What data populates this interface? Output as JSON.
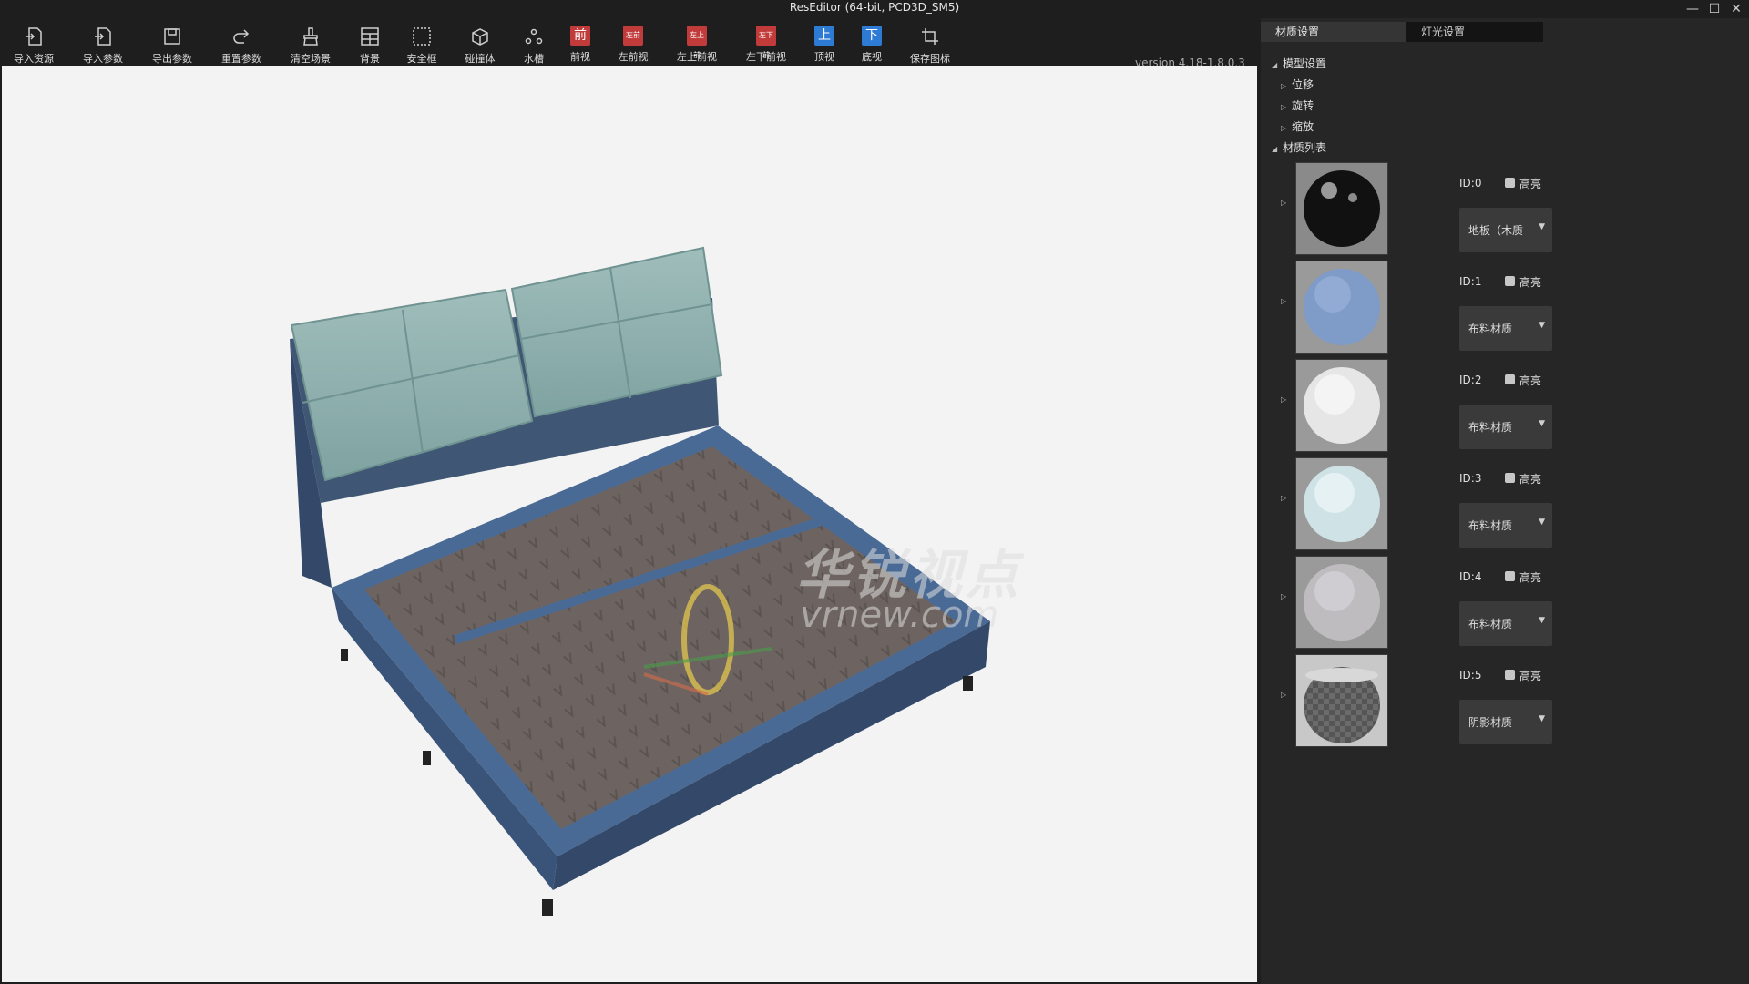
{
  "window": {
    "title": "ResEditor (64-bit, PCD3D_SM5)",
    "controls": [
      "—",
      "☐",
      "✕"
    ]
  },
  "toolbar": {
    "buttons": [
      {
        "label": "导入资源",
        "icon": "import-resource-icon"
      },
      {
        "label": "导入参数",
        "icon": "import-params-icon"
      },
      {
        "label": "导出参数",
        "icon": "export-params-icon"
      },
      {
        "label": "重置参数",
        "icon": "reset-params-icon"
      },
      {
        "label": "清空场景",
        "icon": "clear-scene-icon"
      },
      {
        "label": "背景",
        "icon": "background-icon"
      },
      {
        "label": "安全框",
        "icon": "safe-frame-icon"
      },
      {
        "label": "碰撞体",
        "icon": "collider-icon"
      },
      {
        "label": "水槽",
        "icon": "sink-icon"
      },
      {
        "label": "前视",
        "badge": "前",
        "color": "#c23b3b"
      },
      {
        "label": "左前视",
        "badge": "左前",
        "color": "#c23b3b"
      },
      {
        "label": "左上前视",
        "badge": "左上前",
        "color": "#c23b3b"
      },
      {
        "label": "左下前视",
        "badge": "左下前",
        "color": "#c23b3b"
      },
      {
        "label": "顶视",
        "badge": "上",
        "color": "#2e7bd6"
      },
      {
        "label": "底视",
        "badge": "下",
        "color": "#2e7bd6"
      },
      {
        "label": "保存图标",
        "icon": "crop-icon"
      }
    ],
    "version": "version 4.18-1.8.0.3"
  },
  "panel": {
    "tabs": [
      "材质设置",
      "灯光设置"
    ],
    "tree": {
      "model_settings": "模型设置",
      "translate": "位移",
      "rotate": "旋转",
      "scale": "缩放",
      "material_list": "材质列表"
    },
    "materials": [
      {
        "id": "ID:0",
        "highlight": "高亮",
        "type": "地板（木质",
        "preview": "glossy-black-sphere"
      },
      {
        "id": "ID:1",
        "highlight": "高亮",
        "type": "布料材质",
        "preview": "blue-fabric-sphere"
      },
      {
        "id": "ID:2",
        "highlight": "高亮",
        "type": "布料材质",
        "preview": "white-fabric-sphere"
      },
      {
        "id": "ID:3",
        "highlight": "高亮",
        "type": "布料材质",
        "preview": "pale-cyan-sphere"
      },
      {
        "id": "ID:4",
        "highlight": "高亮",
        "type": "布料材质",
        "preview": "grey-fabric-sphere"
      },
      {
        "id": "ID:5",
        "highlight": "高亮",
        "type": "阴影材质",
        "preview": "checker-shadow-sphere"
      }
    ]
  },
  "viewport": {
    "watermark_cn": "华锐视点",
    "watermark_en": "vrnew.com"
  },
  "colors": {
    "front_view_red": "#c23b3b",
    "top_view_blue": "#2e7bd6",
    "panel_bg": "#262626",
    "viewport_bg": "#f3f3f3"
  }
}
